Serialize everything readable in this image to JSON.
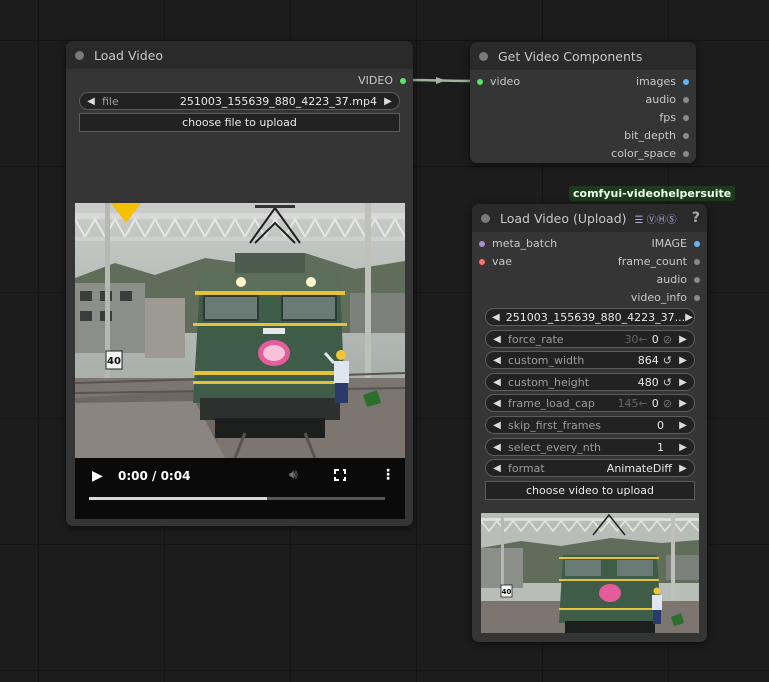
{
  "load_video": {
    "title": "Load Video",
    "output_label": "VIDEO",
    "file_widget": {
      "label": "file",
      "value": "251003_155639_880_4223_37.mp4"
    },
    "upload_button": "choose file to upload",
    "player": {
      "time": "0:00 / 0:04",
      "progress": 0.6,
      "sign": "40"
    }
  },
  "get_components": {
    "title": "Get Video Components",
    "input_label": "video",
    "outputs": [
      "images",
      "audio",
      "fps",
      "bit_depth",
      "color_space"
    ]
  },
  "vhs_node": {
    "badge": "comfyui-videohelpersuite",
    "title": "Load Video (Upload)",
    "title_icons": "☰ ⓋⒽⓈ",
    "help": "?",
    "inputs": [
      "meta_batch",
      "vae"
    ],
    "outputs": [
      "IMAGE",
      "frame_count",
      "audio",
      "video_info"
    ],
    "widgets": {
      "video": {
        "value": "251003_155639_880_4223_37..."
      },
      "force_rate": {
        "label": "force_rate",
        "hint": "30←",
        "value": "0"
      },
      "custom_width": {
        "label": "custom_width",
        "value": "864"
      },
      "custom_height": {
        "label": "custom_height",
        "value": "480"
      },
      "frame_load_cap": {
        "label": "frame_load_cap",
        "hint": "145←",
        "value": "0"
      },
      "skip_first_frames": {
        "label": "skip_first_frames",
        "value": "0"
      },
      "select_every_nth": {
        "label": "select_every_nth",
        "value": "1"
      },
      "format": {
        "label": "format",
        "value": "AnimateDiff"
      }
    },
    "upload_button": "choose video to upload"
  },
  "colors": {
    "video_socket": "#5ce36b",
    "image_socket": "#64b5f6",
    "grey_socket": "#8a8a8a",
    "vae_socket": "#ff6e6e",
    "meta_socket": "#a88cd0",
    "link": "#9cb59c",
    "badge_bg": "#1d3a1d"
  }
}
